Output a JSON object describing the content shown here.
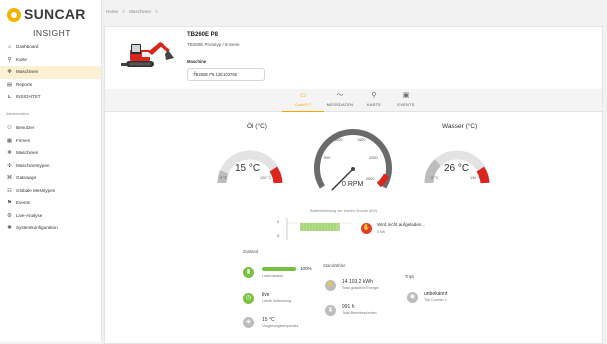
{
  "brand": {
    "name": "SUNCAR",
    "product": "INSIGHT"
  },
  "breadcrumb": [
    "Home",
    ">",
    "Maschinen",
    ">"
  ],
  "sidebar": {
    "main_items": [
      {
        "label": "Dashboard",
        "icon": "home-icon"
      },
      {
        "label": "Karte",
        "icon": "location-pin-icon"
      },
      {
        "label": "Maschinen",
        "icon": "machine-icon",
        "active": true
      },
      {
        "label": "Reports",
        "icon": "report-icon"
      },
      {
        "label": "INSIGHTST",
        "icon": "analytics-icon"
      }
    ],
    "admin_label": "Administration",
    "admin_items": [
      {
        "label": "Benutzer",
        "icon": "user-icon"
      },
      {
        "label": "Firmen",
        "icon": "building-icon"
      },
      {
        "label": "Maschinen",
        "icon": "machine-icon"
      },
      {
        "label": "Maschinentypen",
        "icon": "machine-type-icon"
      },
      {
        "label": "Gateways",
        "icon": "gateway-icon"
      },
      {
        "label": "Globale Messtypen",
        "icon": "measure-icon"
      },
      {
        "label": "Events",
        "icon": "event-icon"
      },
      {
        "label": "Live-Analyse",
        "icon": "live-analysis-icon"
      },
      {
        "label": "Systemkonfiguration",
        "icon": "settings-icon"
      }
    ]
  },
  "machine": {
    "title": "TB260E P8",
    "subtitle": "TB260E Prototyp / 8-Serie",
    "select_label": "Maschine",
    "select_value": "TB260E P8 12E103756"
  },
  "tabs": [
    {
      "label": "CockPIT",
      "icon": "cockpit-icon",
      "active": true
    },
    {
      "label": "MESSDATEN",
      "icon": "chart-line-icon",
      "active": false
    },
    {
      "label": "KARTE",
      "icon": "location-pin-icon",
      "active": false
    },
    {
      "label": "EVENTS",
      "icon": "calendar-icon",
      "active": false
    }
  ],
  "gauges": {
    "oil": {
      "title": "Öl (°C)",
      "value": "15 °C",
      "min": "0 °C",
      "max": "120 °C",
      "fraction": 0.13,
      "accent": "#d9251d"
    },
    "rpm": {
      "ticks": [
        "500",
        "1000",
        "1500",
        "2000",
        "2500"
      ],
      "readout": "0 RPM",
      "fraction": 0.0
    },
    "water": {
      "title": "Wasser (°C)",
      "value": "26 °C",
      "min": "0 °C",
      "max": "100 °C",
      "fraction": 0.26,
      "accent": "#d9251d"
    }
  },
  "battery_chart": {
    "title": "Batterieleistung der letzten Stunde (kW)",
    "y_ticks": [
      "0",
      "-5"
    ],
    "status_text": "Wird nicht aufgeladen...",
    "status_sub": "0 kW",
    "status_color": "#e23b2b"
  },
  "status": {
    "heading": "Zustand",
    "items": [
      {
        "icon": "battery-icon",
        "color": "#7ac143",
        "value": "100%",
        "label": "Ladezustand",
        "bar_fraction": 1.0
      },
      {
        "icon": "clock-icon",
        "color": "#7ac143",
        "value": "live",
        "label": "Letzte Verbindung"
      },
      {
        "icon": "thermometer-icon",
        "color": "#bdbdbd",
        "value": "15 °C",
        "label": "Umgebungstemperatur"
      }
    ]
  },
  "counters": {
    "heading": "Standzähler",
    "items": [
      {
        "icon": "energy-icon",
        "color": "#bdbdbd",
        "value": "14.103,2 kWh",
        "label": "Total geladene Energie"
      },
      {
        "icon": "hourglass-icon",
        "color": "#bdbdbd",
        "value": "991 h",
        "label": "Total Betriebsstunden"
      }
    ]
  },
  "trips": {
    "heading": "Trips",
    "items": [
      {
        "icon": "trip-icon",
        "color": "#bdbdbd",
        "value": "unbekannt",
        "label": "Trip Counter 1"
      }
    ]
  },
  "colors": {
    "accent": "#f5a800",
    "green": "#7ac143",
    "red": "#d9251d"
  }
}
